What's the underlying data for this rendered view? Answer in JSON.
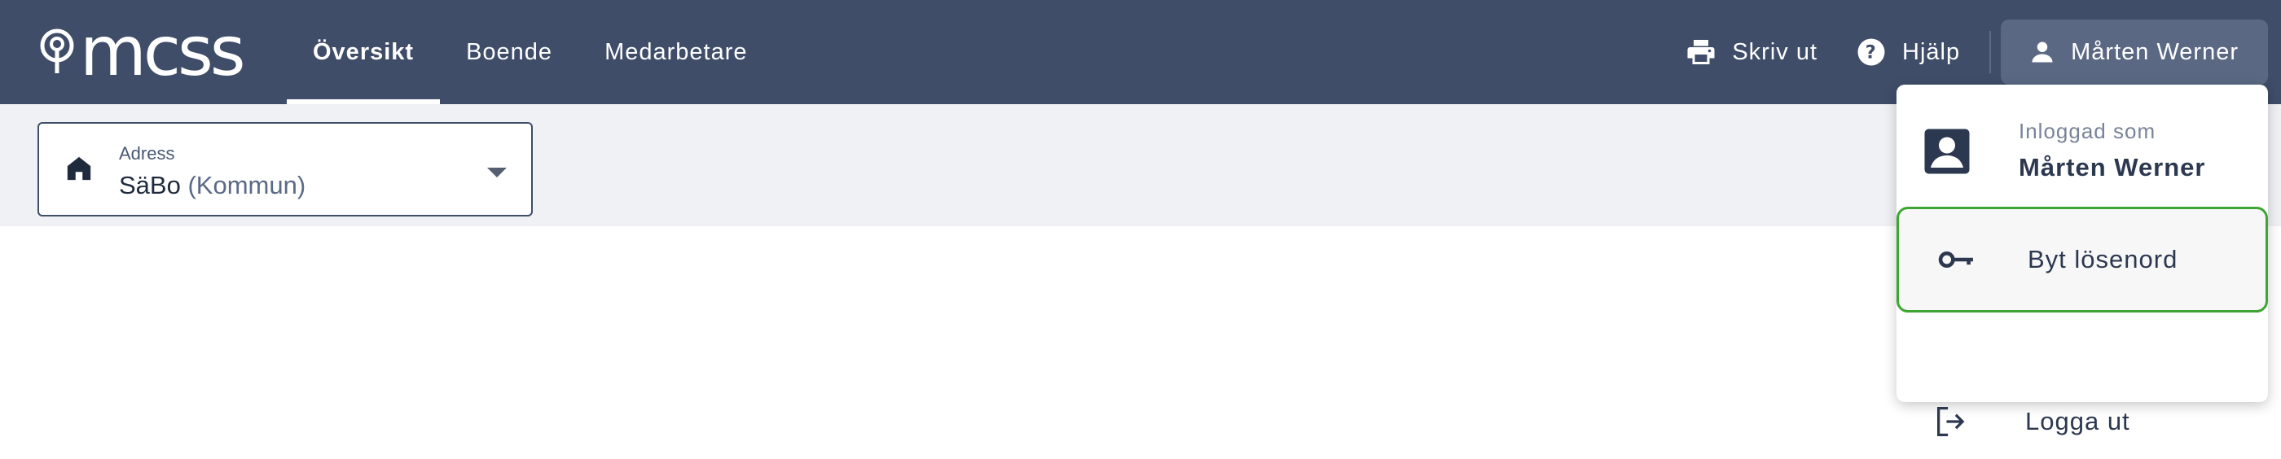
{
  "header": {
    "logo_text": "mcss",
    "nav": [
      {
        "label": "Översikt",
        "active": true
      },
      {
        "label": "Boende",
        "active": false
      },
      {
        "label": "Medarbetare",
        "active": false
      }
    ],
    "print_label": "Skriv ut",
    "help_label": "Hjälp",
    "user_label": "Mårten Werner"
  },
  "address": {
    "label": "Adress",
    "value": "SäBo",
    "value_suffix": "(Kommun)"
  },
  "user_menu": {
    "logged_in_as": "Inloggad som",
    "user_name": "Mårten Werner",
    "change_password": "Byt lösenord",
    "logout": "Logga ut"
  },
  "colors": {
    "header_bg": "#3f4d69",
    "focus_outline": "#3ea535",
    "subbar_bg": "#f0f1f5"
  }
}
